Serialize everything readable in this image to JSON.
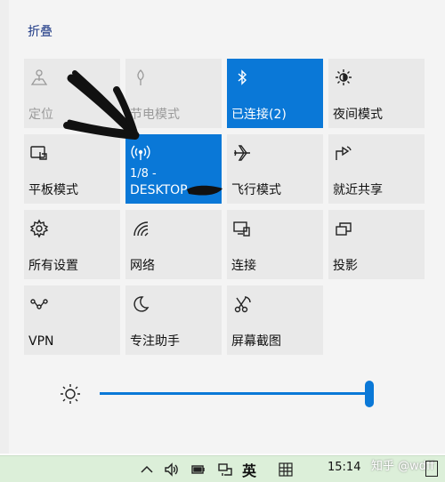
{
  "panel": {
    "collapse_label": "折叠"
  },
  "tiles": [
    {
      "label": "定位",
      "icon": "location-icon",
      "state": "disabled"
    },
    {
      "label": "节电模式",
      "icon": "battery-saver-icon",
      "state": "disabled"
    },
    {
      "label": "已连接(2)",
      "icon": "bluetooth-icon",
      "state": "on"
    },
    {
      "label": "夜间模式",
      "icon": "night-light-icon",
      "state": "off"
    },
    {
      "label": "平板模式",
      "icon": "tablet-mode-icon",
      "state": "off"
    },
    {
      "label": "1/8 -",
      "label2": "DESKTOP-",
      "icon": "mobile-hotspot-icon",
      "state": "on"
    },
    {
      "label": "飞行模式",
      "icon": "airplane-icon",
      "state": "off"
    },
    {
      "label": "就近共享",
      "icon": "nearby-share-icon",
      "state": "off"
    },
    {
      "label": "所有设置",
      "icon": "settings-gear-icon",
      "state": "off"
    },
    {
      "label": "网络",
      "icon": "network-icon",
      "state": "off"
    },
    {
      "label": "连接",
      "icon": "connect-icon",
      "state": "off"
    },
    {
      "label": "投影",
      "icon": "project-icon",
      "state": "off"
    },
    {
      "label": "VPN",
      "icon": "vpn-icon",
      "state": "off"
    },
    {
      "label": "专注助手",
      "icon": "moon-icon",
      "state": "off"
    },
    {
      "label": "屏幕截图",
      "icon": "screen-snip-icon",
      "state": "off"
    }
  ],
  "brightness": {
    "level_percent": 100,
    "icon": "brightness-icon"
  },
  "taskbar": {
    "language": "英",
    "time": "15:14",
    "watermark": "知乎 @wdff"
  },
  "colors": {
    "accent": "#0a78d7",
    "tile_off": "#e9e9e9",
    "panel": "#f4f4f4"
  }
}
